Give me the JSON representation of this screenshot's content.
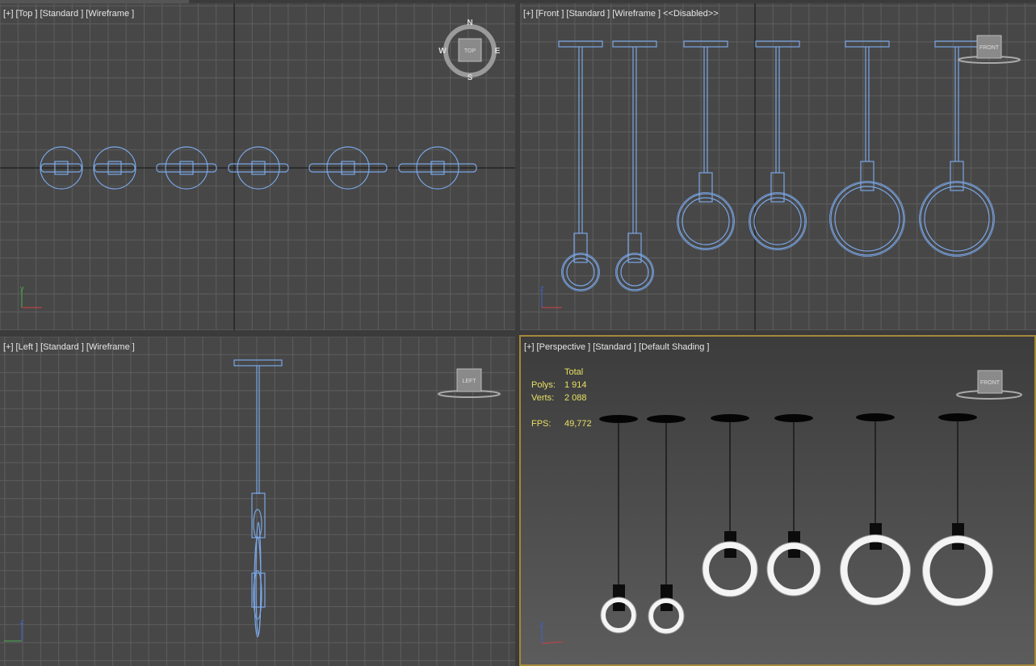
{
  "viewports": {
    "top": {
      "plus": "[+]",
      "view": "[Top ]",
      "mode": "[Standard ]",
      "shading": "[Wireframe ]"
    },
    "front": {
      "plus": "[+]",
      "view": "[Front ]",
      "mode": "[Standard ]",
      "shading": "[Wireframe ]",
      "extra": "<<Disabled>>"
    },
    "left": {
      "plus": "[+]",
      "view": "[Left ]",
      "mode": "[Standard ]",
      "shading": "[Wireframe ]"
    },
    "perspective": {
      "plus": "[+]",
      "view": "[Perspective ]",
      "mode": "[Standard ]",
      "shading": "[Default Shading ]"
    }
  },
  "stats": {
    "total_label": "Total",
    "polys_label": "Polys:",
    "polys_value": "1 914",
    "verts_label": "Verts:",
    "verts_value": "2 088",
    "fps_label": "FPS:",
    "fps_value": "49,772"
  },
  "compass": {
    "n": "N",
    "s": "S",
    "e": "E",
    "w": "W",
    "cube_face": "TOP"
  },
  "viewcube": {
    "front": "FRONT",
    "left": "LEFT",
    "persp": "FRONT"
  },
  "axes": {
    "x": "x",
    "y": "y",
    "z": "z"
  },
  "colors": {
    "wire": "#7aa6e6",
    "grid": "#5e5e5e",
    "stats": "#e8e064",
    "active_border": "#a4883a"
  }
}
